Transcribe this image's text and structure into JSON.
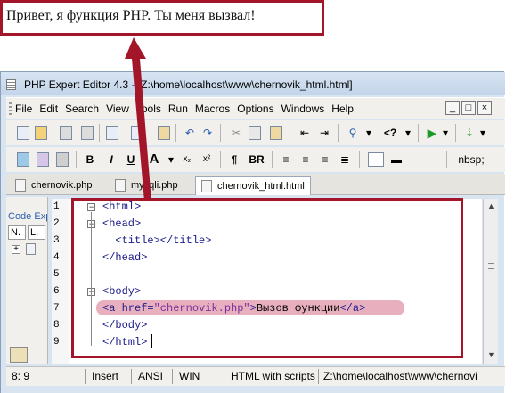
{
  "browser_output": {
    "text": "Привет, я функция PHP. Ты меня вызвал!"
  },
  "window": {
    "title": "PHP Expert Editor 4.3 - [Z:\\home\\localhost\\www\\chernovik_html.html]"
  },
  "menu": {
    "items": [
      "File",
      "Edit",
      "Search",
      "View",
      "Tools",
      "Run",
      "Macros",
      "Options",
      "Windows",
      "Help"
    ],
    "window_buttons": [
      "_",
      "□",
      "×"
    ]
  },
  "toolbar2": {
    "bold": "B",
    "italic": "I",
    "underline": "U",
    "font": "A",
    "sub": "x₂",
    "sup": "x²",
    "para": "¶",
    "br": "BR",
    "nbsp": "nbsp;"
  },
  "toolbar1": {
    "tag_label": "<?",
    "run_icon": "play-icon"
  },
  "tabs": [
    {
      "label": "chernovik.php"
    },
    {
      "label": "mysqli.php"
    },
    {
      "label": "chernovik_html.html"
    }
  ],
  "left_panel": {
    "title": "Code Explorer",
    "col_n": "N.",
    "col_l": "L."
  },
  "editor": {
    "line_numbers": [
      "1",
      "2",
      "3",
      "4",
      "5",
      "6",
      "7",
      "8",
      "9"
    ],
    "lines": {
      "l1": "<html>",
      "l2": "<head>",
      "l3": "  <title></title>",
      "l4": "</head>",
      "l5": "",
      "l6": "<body>",
      "l7_open": "<a href=",
      "l7_str": "\"chernovik.php\"",
      "l7_gt": ">",
      "l7_text": "Вызов функции",
      "l7_close": "</a>",
      "l8": "</body>",
      "l9": "</html>"
    }
  },
  "status": {
    "position": "8: 9",
    "mode": "Insert",
    "encoding": "ANSI",
    "linebreak": "WIN",
    "syntax": "HTML with scripts",
    "path": "Z:\\home\\localhost\\www\\chernovi"
  },
  "colors": {
    "annotation_red": "#a3162a",
    "highlight": "#e4a1b4",
    "tag_blue": "#1a1a8a"
  }
}
